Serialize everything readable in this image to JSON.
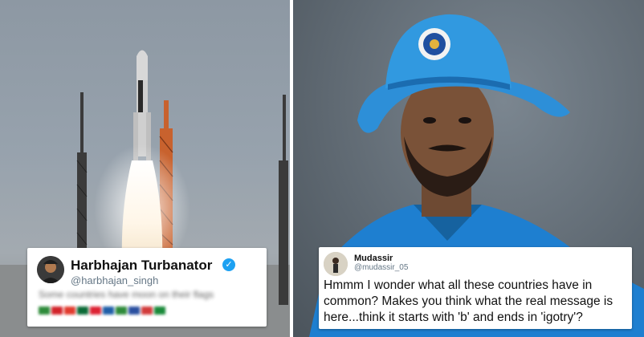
{
  "left_tweet": {
    "name": "Harbhajan Turbanator",
    "handle": "@harbhajan_singh",
    "blurred_text": "Some countries have moon on their flags",
    "verified_icon": "verified-badge-icon",
    "flag_colors": [
      "#2e8b3a",
      "#d2232a",
      "#e23b2e",
      "#0a6a36",
      "#d23",
      "#1f5fa8",
      "#2e8b3a",
      "#2a4fa0",
      "#d23b3b",
      "#1a8a3a"
    ]
  },
  "right_tweet": {
    "name": "Mudassir",
    "handle": "@mudassir_05",
    "text": "Hmmm I wonder what all these countries have in common? Makes you think what the real message is here...think it starts with 'b' and ends in 'igotry'?"
  },
  "colors": {
    "twitter_blue": "#1da1f2",
    "jersey_blue": "#1e7fd0"
  }
}
